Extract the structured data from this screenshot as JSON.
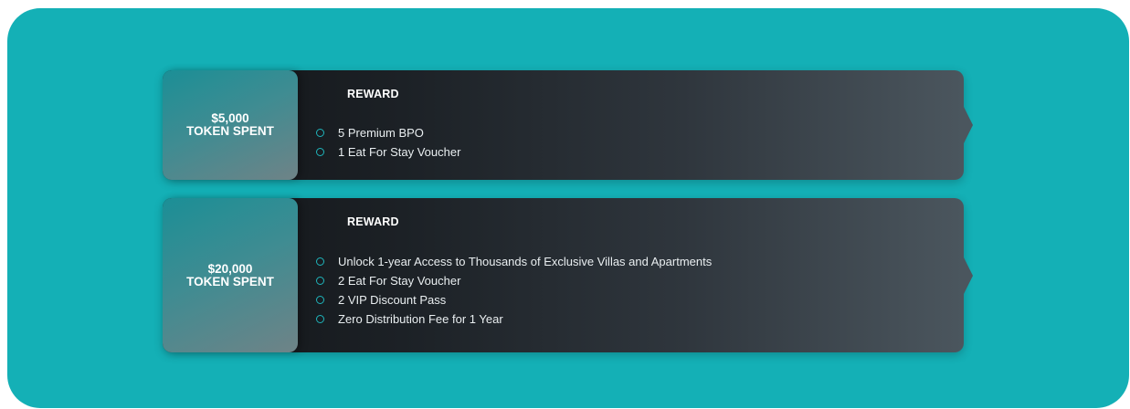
{
  "colors": {
    "panel_background": "#14b0b6",
    "card_dark": "#121417",
    "card_light": "#4b565e",
    "bullet_accent": "#1fb5bb"
  },
  "tiers": [
    {
      "amount": "$5,000",
      "label": "TOKEN SPENT",
      "reward_heading": "REWARD",
      "rewards": [
        "5 Premium BPO",
        "1 Eat For Stay Voucher"
      ]
    },
    {
      "amount": "$20,000",
      "label": "TOKEN SPENT",
      "reward_heading": "REWARD",
      "rewards": [
        "Unlock 1-year Access to Thousands of Exclusive Villas and Apartments",
        "2 Eat For Stay Voucher",
        "2 VIP Discount Pass",
        "Zero Distribution Fee for 1 Year"
      ]
    }
  ]
}
